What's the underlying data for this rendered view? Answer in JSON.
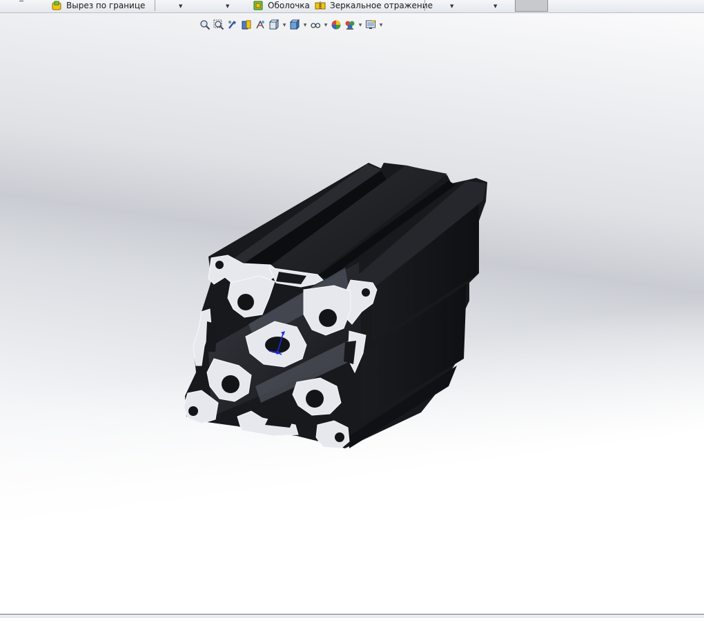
{
  "ribbon": {
    "items": [
      {
        "label": "Вырез по границе",
        "icon": "boundary-cut-icon"
      },
      {
        "label": "Оболочка",
        "icon": "shell-icon"
      },
      {
        "label": "Зеркальное отражение",
        "icon": "mirror-icon"
      }
    ]
  },
  "view_toolbar": {
    "buttons": [
      "zoom-to-fit-icon",
      "zoom-to-area-icon",
      "previous-view-icon",
      "section-view-icon",
      "dynamic-annotation-icon",
      "view-orientation-icon",
      "display-style-icon",
      "hide-show-items-icon",
      "edit-appearance-icon",
      "apply-scene-icon",
      "view-settings-icon"
    ]
  },
  "model": {
    "name": "aluminum-extrusion-profile",
    "body_color": "#1f2024",
    "section_color": "#e6e8ee",
    "triad_color": "#1a2cd6"
  }
}
